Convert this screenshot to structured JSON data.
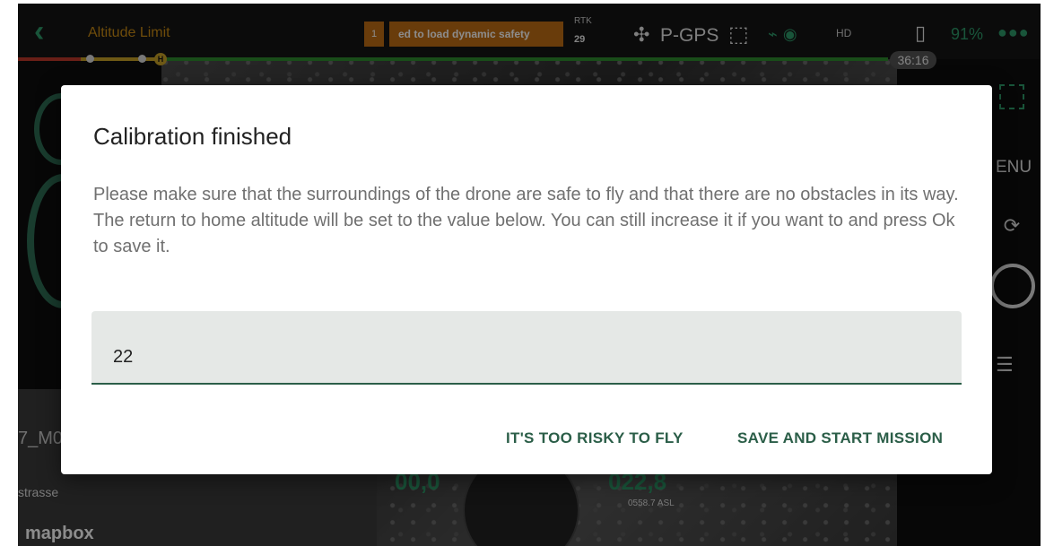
{
  "topbar": {
    "title": "Altitude Limit",
    "warning_count": "1",
    "warning_text": "ed to load dynamic safety",
    "rtk_label": "RTK",
    "satellites": "29",
    "gps_mode": "P-GPS",
    "hd_label": "HD",
    "battery_percent": "91%",
    "flight_time": "36:16"
  },
  "side": {
    "menu_label": "ENU"
  },
  "map": {
    "label": "7_M0",
    "street": "strasse",
    "logo": "mapbox"
  },
  "telemetry": {
    "speed": "00,0",
    "altitude": "022,8",
    "asl": "0558.7 ASL"
  },
  "dialog": {
    "title": "Calibration finished",
    "body_line1": "Please make sure that the surroundings of the drone are safe to fly and that there are no obstacles in its way.",
    "body_line2": "The return to home altitude will be set to the value below. You can still increase it if you want to and press Ok to save it.",
    "input_value": "22",
    "button_risky": "IT'S TOO RISKY TO FLY",
    "button_save": "SAVE AND START MISSION"
  },
  "colors": {
    "accent": "#2b5e48",
    "warning": "#c06d14",
    "status_green": "#2e9b6b"
  },
  "icons": [
    "back-icon",
    "drone-icon",
    "cube-icon",
    "signal-icon",
    "battery-icon",
    "camera-toggle-icon",
    "settings-sliders-icon",
    "frame-icon"
  ]
}
